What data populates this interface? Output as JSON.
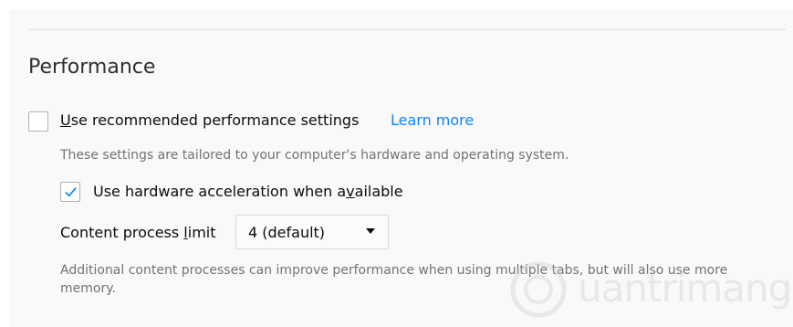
{
  "section": {
    "title": "Performance"
  },
  "recommended": {
    "prefix": "U",
    "label_rest": "se recommended performance settings",
    "checked": false,
    "learn_more": "Learn more",
    "description": "These settings are tailored to your computer's hardware and operating system."
  },
  "hardware": {
    "label_before": "Use hardware acceleration when a",
    "label_accel": "v",
    "label_after": "ailable",
    "checked": true
  },
  "process_limit": {
    "label_before": "Content process ",
    "label_accel": "l",
    "label_after": "imit",
    "selected": "4 (default)",
    "description": "Additional content processes can improve performance when using multiple tabs, but will also use more memory."
  },
  "watermark": {
    "text": "uantrimang"
  },
  "colors": {
    "link": "#0a84ff",
    "check": "#0a84ff",
    "muted_text": "#737373"
  },
  "icons": {
    "checkmark": "checkmark-icon",
    "dropdown": "dropdown-arrow-icon"
  }
}
